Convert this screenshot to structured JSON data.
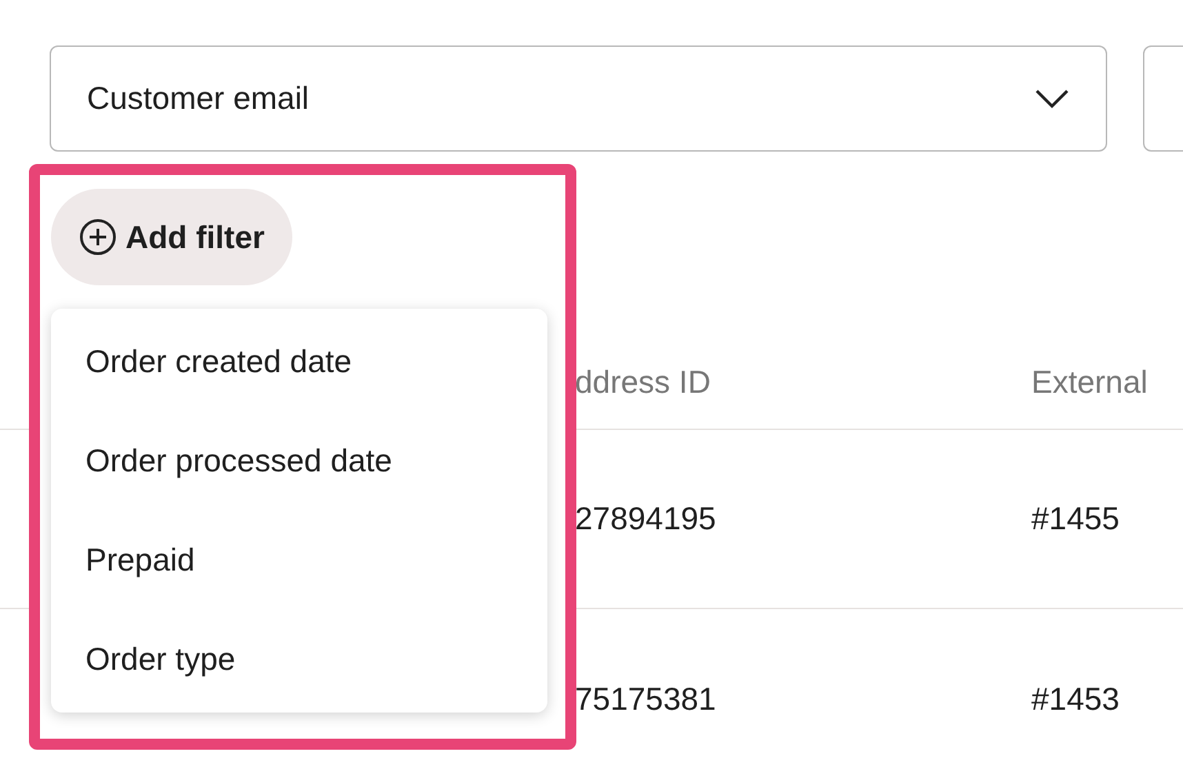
{
  "filter_field": {
    "value": "Customer email"
  },
  "add_filter_button": {
    "label": "Add filter"
  },
  "filter_menu": {
    "items": [
      {
        "label": "Order created date"
      },
      {
        "label": "Order processed date"
      },
      {
        "label": "Prepaid"
      },
      {
        "label": "Order type"
      }
    ]
  },
  "table": {
    "columns": [
      "ddress ID",
      "External"
    ],
    "rows": [
      {
        "cells": [
          "27894195",
          "#1455"
        ]
      },
      {
        "cells": [
          "75175381",
          "#1453"
        ]
      }
    ]
  }
}
